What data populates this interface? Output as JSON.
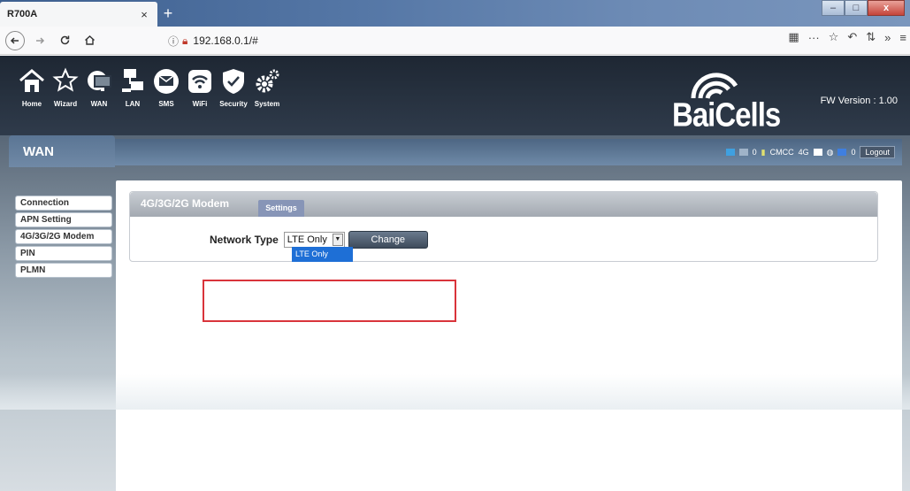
{
  "browser": {
    "tab_title": "R700A",
    "tab_close": "×",
    "new_tab": "+",
    "url": "192.168.0.1/#",
    "win_minimize": "–",
    "win_maximize": "□",
    "win_close": "x"
  },
  "header": {
    "menu": [
      {
        "label": "Home",
        "icon": "home-icon"
      },
      {
        "label": "Wizard",
        "icon": "wizard-icon"
      },
      {
        "label": "WAN",
        "icon": "wan-icon"
      },
      {
        "label": "LAN",
        "icon": "lan-icon"
      },
      {
        "label": "SMS",
        "icon": "sms-icon"
      },
      {
        "label": "WiFi",
        "icon": "wifi-icon"
      },
      {
        "label": "Security",
        "icon": "security-icon"
      },
      {
        "label": "System",
        "icon": "system-icon"
      }
    ],
    "brand": "BaiCells",
    "fw_version": "FW Version : 1.00"
  },
  "section_title": "WAN",
  "status": {
    "sms_count": "0",
    "carrier": "CMCC",
    "network": "4G",
    "wifi_clients": "0",
    "logout": "Logout"
  },
  "sidebar": {
    "items": [
      {
        "label": "Connection"
      },
      {
        "label": "APN Setting"
      },
      {
        "label": "4G/3G/2G Modem"
      },
      {
        "label": "PIN"
      },
      {
        "label": "PLMN"
      }
    ]
  },
  "panel": {
    "title": "4G/3G/2G Modem",
    "tab": "Settings",
    "network_type_label": "Network Type",
    "network_type_value": "LTE Only",
    "dropdown_option": "LTE Only",
    "change_button": "Change"
  },
  "colors": {
    "highlight": "#d9343b",
    "dropdown_selected": "#1e6fd6"
  }
}
